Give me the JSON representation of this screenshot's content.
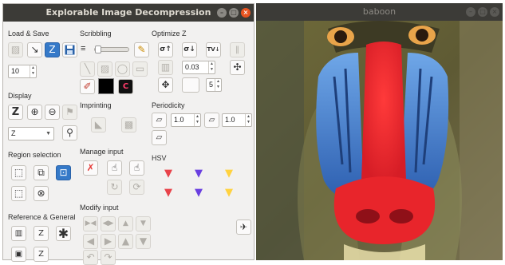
{
  "left_window": {
    "title": "Explorable Image Decompression",
    "controls": {
      "minimize": "–",
      "maximize": "□",
      "close": "×"
    }
  },
  "sections": {
    "load_save": "Load & Save",
    "scribbling": "Scribbling",
    "optimize_z": "Optimize Z",
    "display": "Display",
    "imprinting": "Imprinting",
    "periodicity": "Periodicity",
    "region_selection": "Region selection",
    "manage_input": "Manage input",
    "hsv": "HSV",
    "reference_general": "Reference & General",
    "modify_input": "Modify input"
  },
  "load_save": {
    "buttons": [
      {
        "icon": "load-icon",
        "glyph": "▨"
      },
      {
        "icon": "compress-arrows-icon",
        "glyph": "↘"
      },
      {
        "icon": "load-z-icon",
        "glyph": "Z",
        "selected": true
      },
      {
        "icon": "save-icon",
        "glyph": "💾"
      }
    ],
    "scale_value": "10"
  },
  "scribbling": {
    "brush_icon": "≡",
    "pencil_icon": "✎",
    "color_picker_icon": "✐",
    "color_hex": "#000000",
    "palette_icon": "C"
  },
  "optimize_z": {
    "buttons": [
      "σ↑",
      "σ↓",
      "TV↓",
      "‖"
    ],
    "value": "0.03",
    "iterations": "5"
  },
  "display": {
    "buttons": [
      "Z",
      "🔎",
      "🔍",
      "⚑"
    ],
    "combo_value": "Z"
  },
  "periodicity": {
    "value1": "1.0",
    "value2": "1.0"
  },
  "hsv": {
    "colors": [
      "#e8434a",
      "#6a3fe0",
      "#ffd23f"
    ]
  },
  "right_window": {
    "title": "baboon",
    "controls": {
      "minimize": "–",
      "maximize": "□",
      "close": "×"
    }
  },
  "colors": {
    "titlebar": "#3c3b37",
    "accent": "#e95420",
    "selected": "#3579c8",
    "panel": "#f2f1f0"
  }
}
